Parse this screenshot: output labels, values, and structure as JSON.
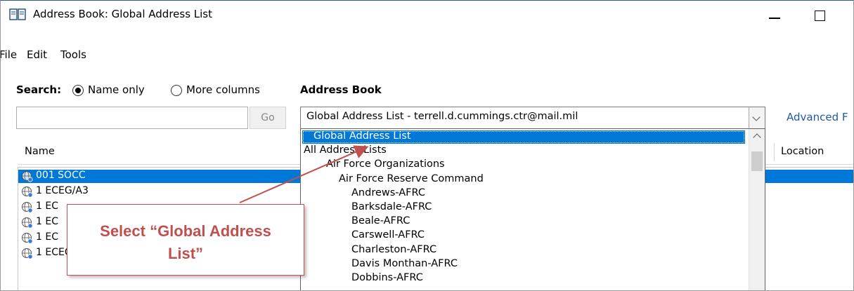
{
  "window": {
    "title": "Address Book: Global Address List"
  },
  "menu": [
    "File",
    "Edit",
    "Tools"
  ],
  "search": {
    "label": "Search:",
    "option_name_only": "Name only",
    "option_more_columns": "More columns",
    "selected_option": "Name only",
    "input_value": "",
    "go_label": "Go"
  },
  "address_book": {
    "label": "Address Book",
    "selected_value": "Global Address List - terrell.d.cummings.ctr@mail.mil",
    "advanced_link": "Advanced F"
  },
  "list": {
    "columns": [
      "Name",
      "Location"
    ],
    "rows": [
      {
        "name": "001 SOCC",
        "selected": true
      },
      {
        "name": "1 ECEG/A3",
        "selected": false
      },
      {
        "name": "1 EC",
        "selected": false
      },
      {
        "name": "1 EC",
        "selected": false
      },
      {
        "name": "1 EC",
        "selected": false
      },
      {
        "name": "1 ECEG/A8-Finance",
        "selected": false
      }
    ]
  },
  "dropdown": {
    "items": [
      {
        "label": "Global Address List",
        "level": 0,
        "selected": true
      },
      {
        "label": "All Address Lists",
        "level": 0,
        "selected": false
      },
      {
        "label": "Air Force Organizations",
        "level": 1,
        "selected": false
      },
      {
        "label": "Air Force Reserve Command",
        "level": 2,
        "selected": false
      },
      {
        "label": "Andrews-AFRC",
        "level": 3,
        "selected": false
      },
      {
        "label": "Barksdale-AFRC",
        "level": 3,
        "selected": false
      },
      {
        "label": "Beale-AFRC",
        "level": 3,
        "selected": false
      },
      {
        "label": "Carswell-AFRC",
        "level": 3,
        "selected": false
      },
      {
        "label": "Charleston-AFRC",
        "level": 3,
        "selected": false
      },
      {
        "label": "Davis Monthan-AFRC",
        "level": 3,
        "selected": false
      },
      {
        "label": "Dobbins-AFRC",
        "level": 3,
        "selected": false
      }
    ]
  },
  "callout": {
    "line1": "Select “Global Address",
    "line2": "List”",
    "color": "#c0504d"
  },
  "colors": {
    "selection": "#0078d7",
    "link": "#1f5aa8"
  }
}
